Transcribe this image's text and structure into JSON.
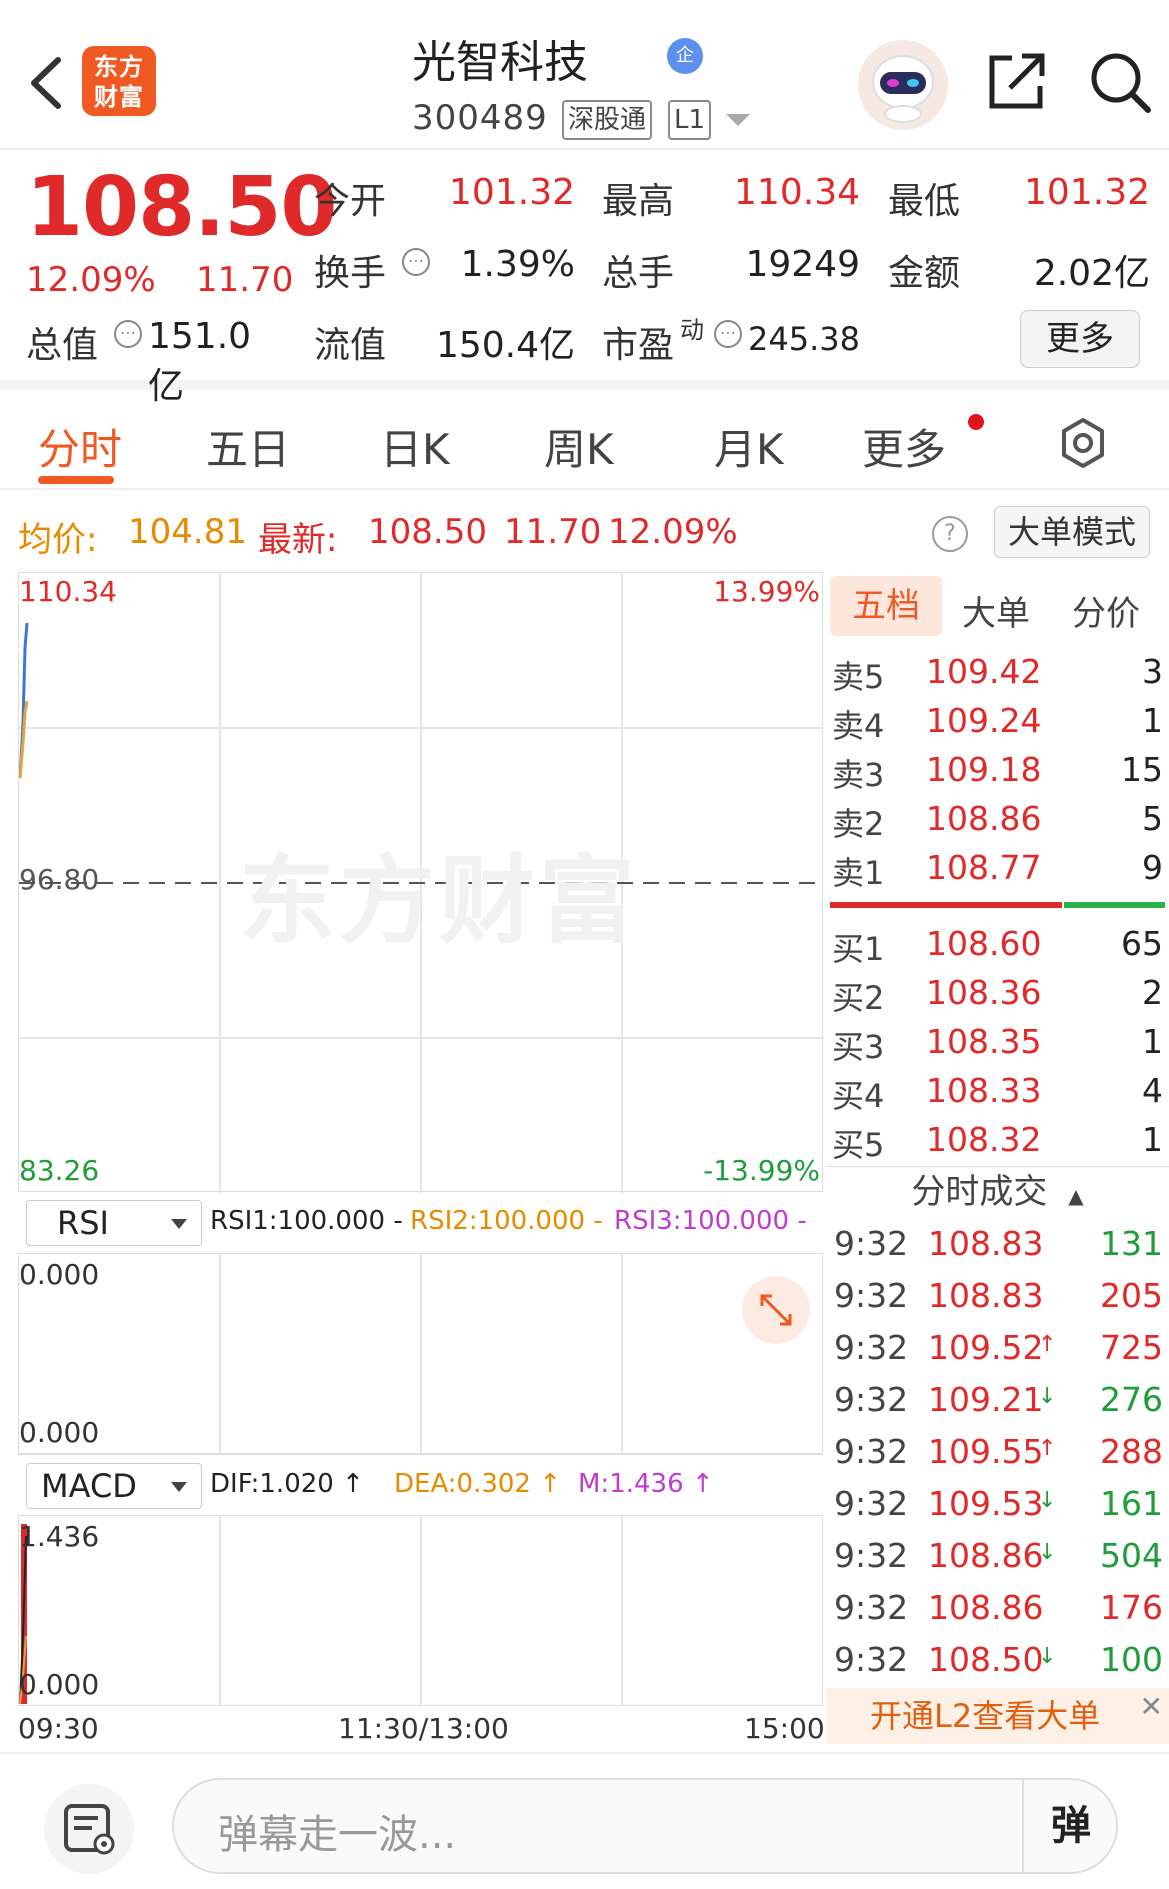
{
  "header": {
    "logo_text_line1": "东方",
    "logo_text_line2": "财富",
    "stock_name": "光智科技",
    "verified_badge": "企",
    "stock_code": "300489",
    "market_tag": "深股通",
    "level_tag": "L1"
  },
  "quote": {
    "last_price": "108.50",
    "change_pct": "12.09%",
    "change_amt": "11.70",
    "open_label": "今开",
    "open": "101.32",
    "high_label": "最高",
    "high": "110.34",
    "low_label": "最低",
    "low": "101.32",
    "turnover_label": "换手",
    "turnover": "1.39%",
    "volume_label": "总手",
    "volume": "19249",
    "amount_label": "金额",
    "amount": "2.02亿",
    "total_cap_label": "总值",
    "total_cap": "151.0亿",
    "float_cap_label": "流值",
    "float_cap": "150.4亿",
    "pe_label": "市盈",
    "pe_sup": "动",
    "pe": "245.38",
    "more_label": "更多"
  },
  "tabs": {
    "intraday": "分时",
    "five_day": "五日",
    "daily": "日K",
    "weekly": "周K",
    "monthly": "月K",
    "more": "更多"
  },
  "info_line": {
    "avg_label": "均价:",
    "avg": "104.81",
    "latest_label": "最新:",
    "latest": "108.50",
    "latest_change": "11.70",
    "latest_pct": "12.09%",
    "help": "?",
    "big_order_mode": "大单模式"
  },
  "chart": {
    "y_top": "110.34",
    "y_mid": "96.80",
    "y_bottom": "83.26",
    "pct_top": "13.99%",
    "pct_bottom": "-13.99%",
    "watermark": "东方财富",
    "time_start": "09:30",
    "time_mid": "11:30/13:00",
    "time_end": "15:00",
    "colors": {
      "price_line": "#3a78d6",
      "avg_line": "#e6a23c",
      "up": "#e02a2a",
      "down": "#1f9d3a"
    }
  },
  "rsi": {
    "name": "RSI",
    "rsi1": "RSI1:100.000 -",
    "rsi2": "RSI2:100.000 -",
    "rsi3": "RSI3:100.000 -",
    "y_top": "0.000",
    "y_bottom": "0.000"
  },
  "macd": {
    "name": "MACD",
    "dif": "DIF:1.020 ↑",
    "dea": "DEA:0.302 ↑",
    "m": "M:1.436 ↑",
    "y_top": "1.436",
    "y_bottom": "0.000"
  },
  "order_book": {
    "tab_five": "五档",
    "tab_big": "大单",
    "tab_price": "分价",
    "asks": [
      {
        "label": "卖5",
        "price": "109.42",
        "vol": "3"
      },
      {
        "label": "卖4",
        "price": "109.24",
        "vol": "1"
      },
      {
        "label": "卖3",
        "price": "109.18",
        "vol": "15"
      },
      {
        "label": "卖2",
        "price": "108.86",
        "vol": "5"
      },
      {
        "label": "卖1",
        "price": "108.77",
        "vol": "9"
      }
    ],
    "bids": [
      {
        "label": "买1",
        "price": "108.60",
        "vol": "65"
      },
      {
        "label": "买2",
        "price": "108.36",
        "vol": "2"
      },
      {
        "label": "买3",
        "price": "108.35",
        "vol": "1"
      },
      {
        "label": "买4",
        "price": "108.33",
        "vol": "4"
      },
      {
        "label": "买5",
        "price": "108.32",
        "vol": "1"
      }
    ],
    "trades_title": "分时成交",
    "trades": [
      {
        "time": "9:32",
        "price": "108.83",
        "arrow": "",
        "vol": "131",
        "side": "buy"
      },
      {
        "time": "9:32",
        "price": "108.83",
        "arrow": "",
        "vol": "205",
        "side": "sell"
      },
      {
        "time": "9:32",
        "price": "109.52",
        "arrow": "↑",
        "vol": "725",
        "side": "sell"
      },
      {
        "time": "9:32",
        "price": "109.21",
        "arrow": "↓",
        "vol": "276",
        "side": "buy"
      },
      {
        "time": "9:32",
        "price": "109.55",
        "arrow": "↑",
        "vol": "288",
        "side": "sell"
      },
      {
        "time": "9:32",
        "price": "109.53",
        "arrow": "↓",
        "vol": "161",
        "side": "buy"
      },
      {
        "time": "9:32",
        "price": "108.86",
        "arrow": "↓",
        "vol": "504",
        "side": "buy"
      },
      {
        "time": "9:32",
        "price": "108.86",
        "arrow": "",
        "vol": "176",
        "side": "sell"
      },
      {
        "time": "9:32",
        "price": "108.50",
        "arrow": "↓",
        "vol": "100",
        "side": "buy"
      }
    ],
    "l2_banner": "开通L2查看大单",
    "l2_close": "✕"
  },
  "bottom": {
    "comment_placeholder": "弹幕走一波...",
    "danmu_button": "弹"
  }
}
